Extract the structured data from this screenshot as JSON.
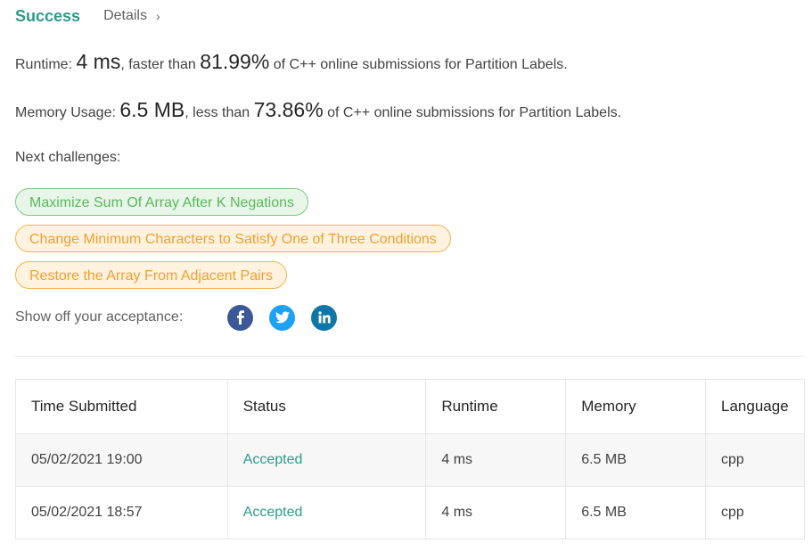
{
  "header": {
    "status": "Success",
    "details_label": "Details",
    "details_chevron": "›"
  },
  "runtime": {
    "label": "Runtime:",
    "value": "4 ms",
    "comparison": ", faster than",
    "percent": "81.99%",
    "suffix": "of C++ online submissions for Partition Labels."
  },
  "memory": {
    "label": "Memory Usage:",
    "value": "6.5 MB",
    "comparison": ", less than",
    "percent": "73.86%",
    "suffix": "of C++ online submissions for Partition Labels."
  },
  "next_challenges": {
    "label": "Next challenges:",
    "items": [
      {
        "label": "Maximize Sum Of Array After K Negations",
        "difficulty": "easy",
        "color": "#5cb85c"
      },
      {
        "label": "Change Minimum Characters to Satisfy One of Three Conditions",
        "difficulty": "medium",
        "color": "#f0a030"
      },
      {
        "label": "Restore the Array From Adjacent Pairs",
        "difficulty": "medium",
        "color": "#f0a030"
      }
    ]
  },
  "share": {
    "label": "Show off your acceptance:",
    "icons": [
      "facebook-icon",
      "twitter-icon",
      "linkedin-icon"
    ],
    "colors": {
      "facebook": "#3b5998",
      "twitter": "#1da1f2",
      "linkedin": "#0e76a8"
    }
  },
  "submissions": {
    "columns": [
      "Time Submitted",
      "Status",
      "Runtime",
      "Memory",
      "Language"
    ],
    "rows": [
      {
        "time": "05/02/2021 19:00",
        "status": "Accepted",
        "runtime": "4 ms",
        "memory": "6.5 MB",
        "language": "cpp"
      },
      {
        "time": "05/02/2021 18:57",
        "status": "Accepted",
        "runtime": "4 ms",
        "memory": "6.5 MB",
        "language": "cpp"
      }
    ]
  },
  "colors": {
    "accent": "#2e9a8a",
    "easy": "#5cb85c",
    "medium": "#f0a030"
  }
}
